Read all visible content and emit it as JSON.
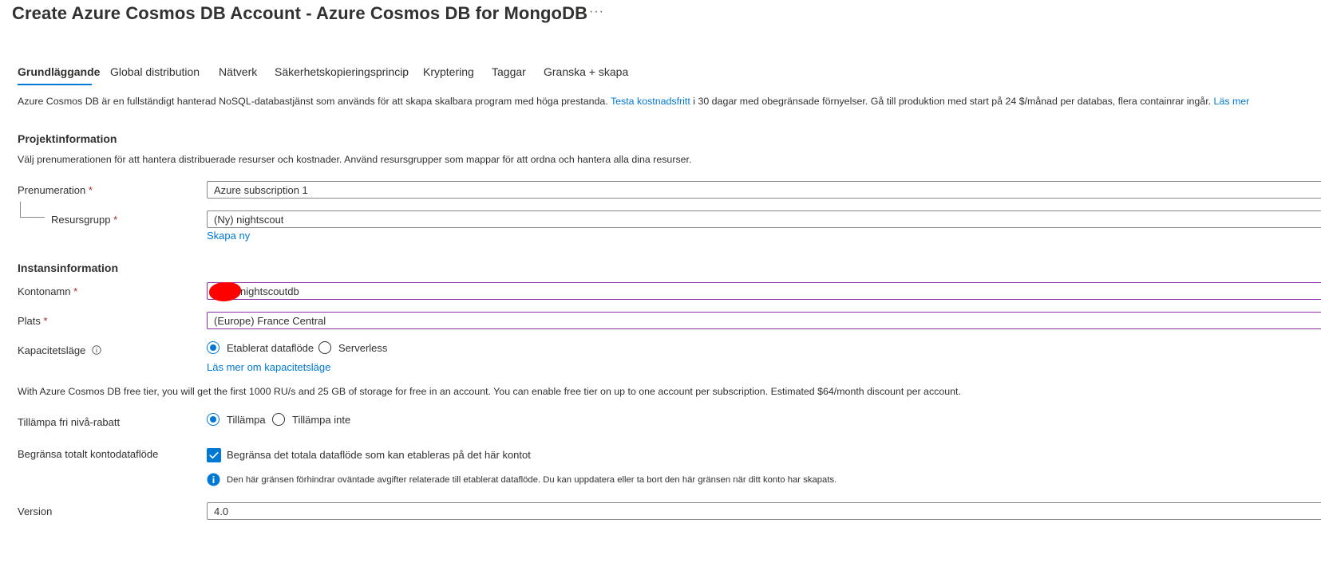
{
  "header": {
    "title": "Create Azure Cosmos DB Account - Azure Cosmos DB for MongoDB",
    "more_label": "···"
  },
  "tabs": [
    {
      "label": "Grundläggande",
      "active": true
    },
    {
      "label": "Global distribution"
    },
    {
      "label": "Nätverk"
    },
    {
      "label": "Säkerhetskopieringsprincip"
    },
    {
      "label": "Kryptering"
    },
    {
      "label": "Taggar"
    },
    {
      "label": "Granska + skapa"
    }
  ],
  "intro": {
    "text": "Azure Cosmos DB är en fullständigt hanterad NoSQL-databastjänst som används för att skapa skalbara program med höga prestanda.",
    "link1": "Testa kostnadsfritt",
    "text2": "i 30 dagar med obegränsade förnyelser. Gå till produktion med start på 24 $/månad per databas, flera containrar ingår.",
    "link2": "Läs mer"
  },
  "project": {
    "heading": "Projektinformation",
    "description": "Välj prenumerationen för att hantera distribuerade resurser och kostnader. Använd resursgrupper som mappar för att ordna och hantera alla dina resurser.",
    "subscription_label": "Prenumeration",
    "subscription_value": "Azure subscription 1",
    "resource_group_label": "Resursgrupp",
    "resource_group_value": "(Ny) nightscout",
    "create_new_link": "Skapa ny"
  },
  "instance": {
    "heading": "Instansinformation",
    "account_name_label": "Kontonamn",
    "account_name_value": "nightscoutdb",
    "location_label": "Plats",
    "location_value": "(Europe) France Central",
    "capacity_label": "Kapacitetsläge",
    "capacity_options": [
      "Etablerat dataflöde",
      "Serverless"
    ],
    "capacity_selected": "Etablerat dataflöde",
    "capacity_link": "Läs mer om kapacitetsläge"
  },
  "free_tier": {
    "info": "With Azure Cosmos DB free tier, you will get the first 1000 RU/s and 25 GB of storage for free in an account. You can enable free tier on up to one account per subscription. Estimated $64/month discount per account.",
    "label": "Tillämpa fri nivå-rabatt",
    "options": [
      "Tillämpa",
      "Tillämpa inte"
    ],
    "selected": "Tillämpa"
  },
  "throughput_limit": {
    "label": "Begränsa totalt kontodataflöde",
    "checkbox_label": "Begränsa det totala dataflöde som kan etableras på det här kontot",
    "checked": true,
    "info": "Den här gränsen förhindrar oväntade avgifter relaterade till etablerat dataflöde. Du kan uppdatera eller ta bort den här gränsen när ditt konto har skapats."
  },
  "version": {
    "label": "Version",
    "value": "4.0"
  },
  "required_marker": "*",
  "colors": {
    "accent": "#0078d4",
    "required": "#a4262c",
    "focus_border": "#8a2da5",
    "redaction": "#ff0000"
  }
}
